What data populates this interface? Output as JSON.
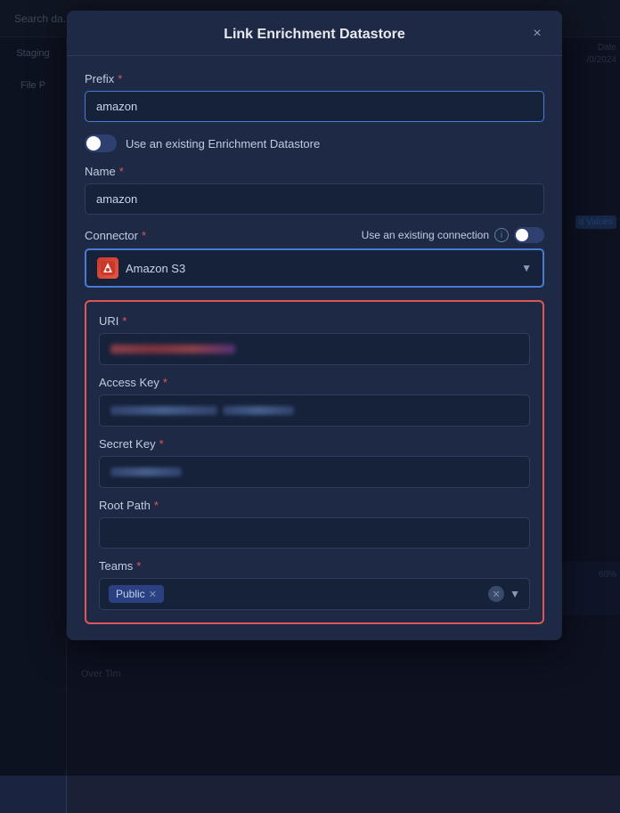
{
  "modal": {
    "title": "Link Enrichment Datastore",
    "close_label": "×"
  },
  "prefix": {
    "label": "Prefix",
    "value": "amazon"
  },
  "existing_datastore_toggle": {
    "label": "Use an existing Enrichment Datastore",
    "enabled": false
  },
  "name": {
    "label": "Name",
    "value": "amazon"
  },
  "connector": {
    "label": "Connector",
    "selected": "Amazon S3"
  },
  "existing_connection": {
    "label": "Use an existing connection",
    "enabled": false
  },
  "uri": {
    "label": "URI"
  },
  "access_key": {
    "label": "Access Key"
  },
  "secret_key": {
    "label": "Secret Key"
  },
  "root_path": {
    "label": "Root Path"
  },
  "teams": {
    "label": "Teams",
    "tag": "Public"
  },
  "required_indicator": "*"
}
